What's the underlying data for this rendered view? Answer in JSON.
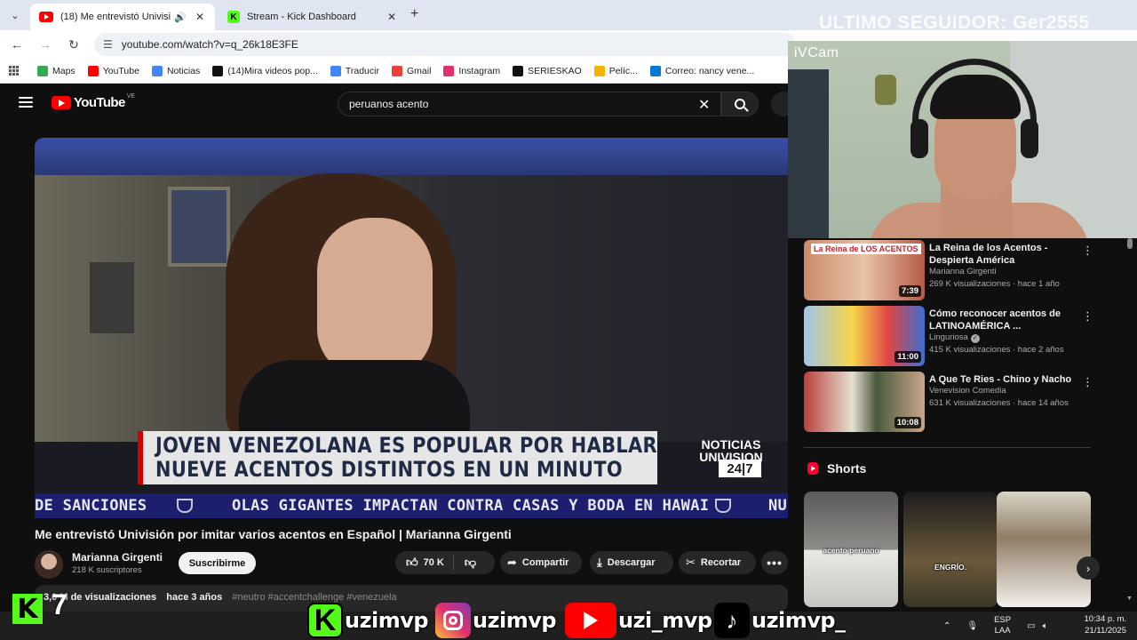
{
  "browser": {
    "tabs": [
      {
        "title": "(18) Me entrevistó Univisión",
        "active": true
      },
      {
        "title": "Stream - Kick Dashboard",
        "active": false
      }
    ],
    "url": "youtube.com/watch?v=q_26k18E3FE",
    "bookmarks": [
      {
        "label": "Maps",
        "color": "#34a853"
      },
      {
        "label": "YouTube",
        "color": "#ff0000"
      },
      {
        "label": "Noticias",
        "color": "#4285f4"
      },
      {
        "label": "(14)Mira videos pop...",
        "color": "#111111"
      },
      {
        "label": "Traducir",
        "color": "#4285f4"
      },
      {
        "label": "Gmail",
        "color": "#ea4335"
      },
      {
        "label": "Instagram",
        "color": "#e1306c"
      },
      {
        "label": "SERIESKAO",
        "color": "#111111"
      },
      {
        "label": "Pelíc...",
        "color": "#f4b400"
      },
      {
        "label": "Correo: nancy vene...",
        "color": "#0078d4"
      }
    ]
  },
  "overlay": {
    "last_follower": "ULTIMO SEGUIDOR: Ger2555",
    "cam_label": "iVCam",
    "score": "7",
    "socials": [
      {
        "type": "kick",
        "glyph": "K",
        "handle": "uzimvp"
      },
      {
        "type": "instagram",
        "glyph": "",
        "handle": "uzimvp"
      },
      {
        "type": "youtube",
        "glyph": "",
        "handle": "uzi_mvp"
      },
      {
        "type": "tiktok",
        "glyph": "♪",
        "handle": "uzimvp_"
      }
    ]
  },
  "youtube": {
    "country_code": "VE",
    "logo_text": "YouTube",
    "search_query": "peruanos acento",
    "player": {
      "headline_line1": "JOVEN VENEZOLANA ES POPULAR POR HABLAR",
      "headline_line2": "NUEVE ACENTOS DISTINTOS EN UN MINUTO",
      "brand_line1": "NOTICIAS",
      "brand_line2": "UNIVISION",
      "brand_247": "24|7",
      "ticker_1": "DE SANCIONES",
      "ticker_2": "OLAS GIGANTES IMPACTAN CONTRA CASAS Y BODA EN HAWAI",
      "ticker_3": "NU"
    },
    "video": {
      "title": "Me entrevistó Univisión por imitar varios acentos en Español | Marianna Girgenti",
      "channel": "Marianna Girgenti",
      "subscribers": "218 K suscriptores",
      "subscribe_label": "Suscribirme",
      "likes": "70 K",
      "share_label": "Compartir",
      "download_label": "Descargar",
      "clip_label": "Recortar",
      "views": "3,0 M de visualizaciones",
      "age": "hace 3 años",
      "tags": "#neutro #accentchallenge #venezuela"
    },
    "related": [
      {
        "title": "La Reina de los Acentos - Despierta América",
        "channel": "Marianna Girgenti",
        "verified": false,
        "meta": "269 K visualizaciones · hace 1 año",
        "duration": "7:39",
        "thumb_caption": "La Reina de LOS ACENTOS"
      },
      {
        "title": "Cómo reconocer acentos de LATINOAMÉRICA ...",
        "channel": "Linguriosa",
        "verified": true,
        "meta": "415 K visualizaciones · hace 2 años",
        "duration": "11:00",
        "thumb_caption": ""
      },
      {
        "title": "A Que Te Ries - Chino y Nacho",
        "channel": "Venevision Comedia",
        "verified": false,
        "meta": "631 K visualizaciones · hace 14 años",
        "duration": "10:08",
        "thumb_caption": ""
      }
    ],
    "shorts_title": "Shorts",
    "shorts": [
      {
        "caption": "acento peruano"
      },
      {
        "caption": "ENGRÍO."
      },
      {
        "caption": ""
      }
    ]
  },
  "taskbar": {
    "lang_1": "ESP",
    "lang_2": "LAA",
    "time": "10:34 p. m.",
    "date": "21/11/2025"
  }
}
